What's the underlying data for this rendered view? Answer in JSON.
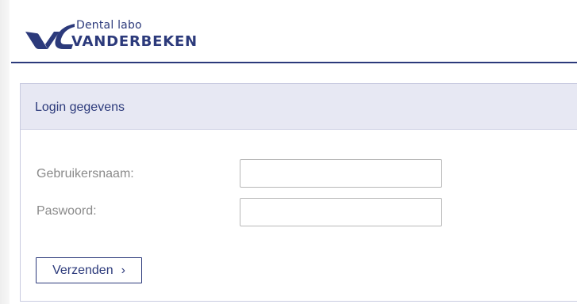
{
  "header": {
    "logo": {
      "line1": "Dental labo",
      "line2": "VANDERBEKEN",
      "icon": "vg-logo-mark-icon"
    }
  },
  "form": {
    "section_title": "Login gegevens",
    "username_label": "Gebruikersnaam:",
    "username_value": "",
    "password_label": "Paswoord:",
    "password_value": "",
    "submit_label": "Verzenden",
    "submit_icon": "chevron-right-icon"
  },
  "colors": {
    "brand": "#2c3a7b",
    "panel_header_bg": "#e7e8f3",
    "label_gray": "#8a8a8a"
  }
}
